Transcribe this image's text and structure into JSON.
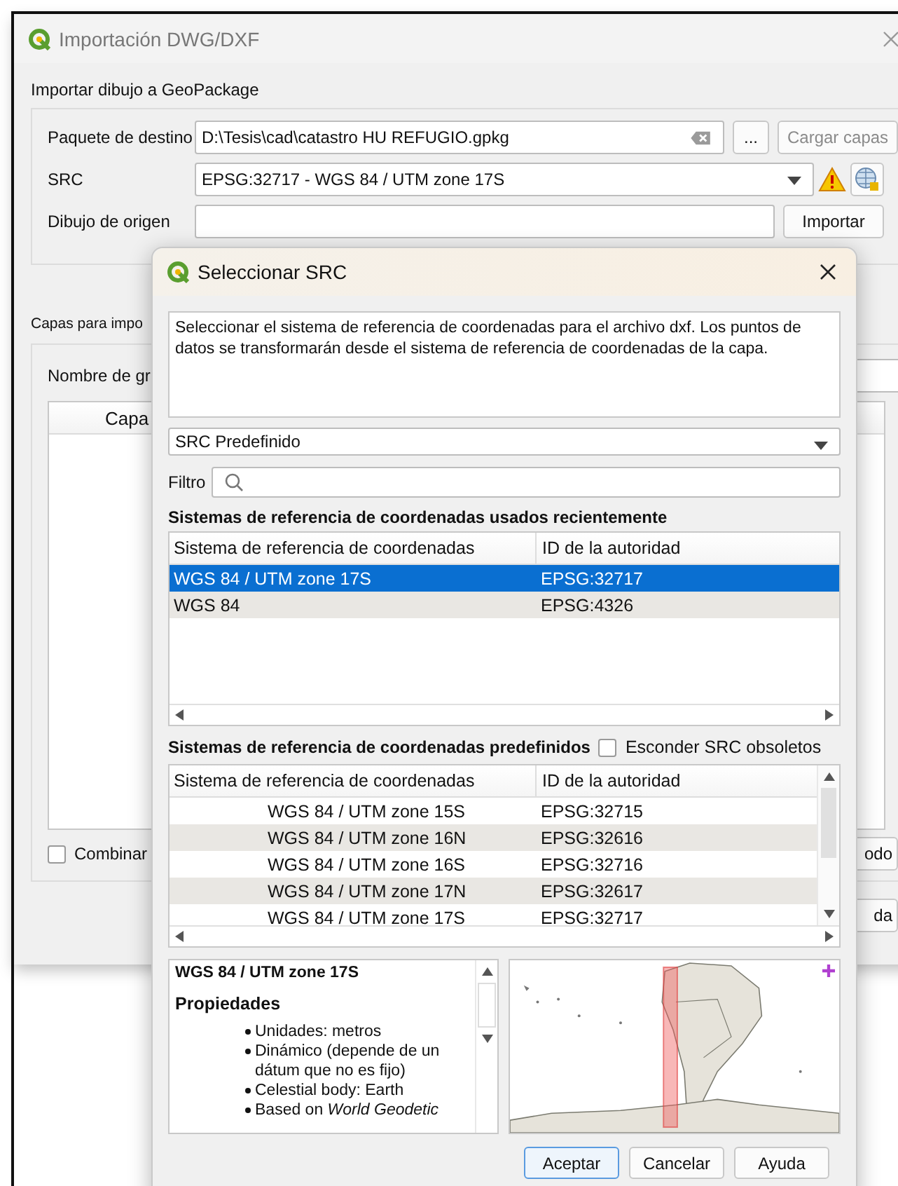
{
  "back_window": {
    "title": "Importación DWG/DXF",
    "section_label": "Importar dibujo a GeoPackage",
    "destination": {
      "label": "Paquete de destino",
      "value": "D:\\Tesis\\cad\\catastro HU REFUGIO.gpkg"
    },
    "browse_button": "...",
    "load_button": {
      "label": "Cargar capas",
      "disabled": true
    },
    "crs": {
      "label": "SRC",
      "value": "EPSG:32717 - WGS 84 / UTM zone 17S"
    },
    "source": {
      "label": "Dibujo de origen"
    },
    "import_button": "Importar",
    "layers_group_title": "Capas para impo",
    "group_name_label": "Nombre de gr",
    "layers_table": {
      "columns": [
        "Capa"
      ]
    },
    "merge_checkbox": {
      "label": "Combinar",
      "checked": false
    },
    "partial_buttons": [
      "odo",
      "da"
    ]
  },
  "crs_dialog": {
    "title": "Seleccionar SRC",
    "description": "Seleccionar el sistema de referencia de coordenadas para el archivo dxf. Los puntos de datos se transformarán desde el sistema de referencia de coordenadas de la capa.",
    "preset": "SRC Predefinido",
    "filter_label": "Filtro",
    "recent": {
      "title": "Sistemas de referencia de coordenadas usados recientemente",
      "columns": [
        "Sistema de referencia de coordenadas",
        "ID de la autoridad"
      ],
      "rows": [
        {
          "name": "WGS 84 / UTM zone 17S",
          "id": "EPSG:32717",
          "selected": true
        },
        {
          "name": "WGS 84",
          "id": "EPSG:4326",
          "selected": false
        }
      ]
    },
    "predefined": {
      "title": "Sistemas de referencia de coordenadas predefinidos",
      "hide_obsolete": {
        "label": "Esconder SRC obsoletos",
        "checked": false
      },
      "columns": [
        "Sistema de referencia de coordenadas",
        "ID de la autoridad"
      ],
      "rows": [
        {
          "name": "WGS 84 / UTM zone 15S",
          "id": "EPSG:32715",
          "selected": false
        },
        {
          "name": "WGS 84 / UTM zone 16N",
          "id": "EPSG:32616",
          "selected": false
        },
        {
          "name": "WGS 84 / UTM zone 16S",
          "id": "EPSG:32716",
          "selected": false
        },
        {
          "name": "WGS 84 / UTM zone 17N",
          "id": "EPSG:32617",
          "selected": false
        },
        {
          "name": "WGS 84 / UTM zone 17S",
          "id": "EPSG:32717",
          "selected": false
        }
      ]
    },
    "details": {
      "heading": "WGS 84 / UTM zone 17S",
      "properties_heading": "Propiedades",
      "items": [
        "Unidades: metros",
        "Dinámico (depende de un dátum que no es fijo)",
        "Celestial body: Earth",
        "Based on *World Geodetic*"
      ]
    },
    "buttons": [
      {
        "label": "Aceptar",
        "default": true
      },
      {
        "label": "Cancelar",
        "default": false
      },
      {
        "label": "Ayuda",
        "default": false
      }
    ]
  }
}
